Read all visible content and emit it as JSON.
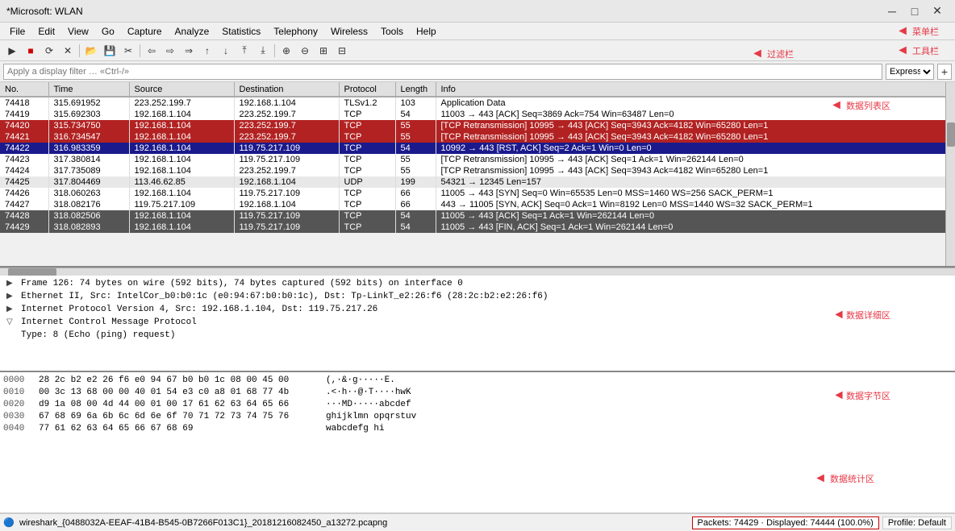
{
  "window": {
    "title": "*Microsoft: WLAN",
    "min_btn": "─",
    "max_btn": "□",
    "close_btn": "✕"
  },
  "menubar": {
    "items": [
      "File",
      "Edit",
      "View",
      "Go",
      "Capture",
      "Analyze",
      "Statistics",
      "Telephony",
      "Wireless",
      "Tools",
      "Help"
    ],
    "annotation": "菜单栏"
  },
  "toolbar": {
    "annotation": "工具栏",
    "buttons": [
      "▶",
      "■",
      "⟳",
      "✕",
      "⎙",
      "✂",
      "📋",
      "⬤",
      "↩",
      "→",
      "⇒",
      "⤼",
      "↑",
      "⬇",
      "↕",
      "⊕",
      "⊖",
      "⊕",
      "⊖",
      "⊞",
      "⊟"
    ]
  },
  "filterbar": {
    "placeholder": "Apply a display filter … «Ctrl-/»",
    "expression_btn": "Expression…",
    "add_btn": "+",
    "annotation": "过滤栏"
  },
  "columns": [
    "No.",
    "Time",
    "Source",
    "Destination",
    "Protocol",
    "Length",
    "Info"
  ],
  "packets": [
    {
      "no": "74418",
      "time": "315.691952",
      "src": "223.252.199.7",
      "dst": "192.168.1.104",
      "proto": "TLSv1.2",
      "len": "103",
      "info": "Application Data",
      "style": "row-white"
    },
    {
      "no": "74419",
      "time": "315.692303",
      "src": "192.168.1.104",
      "dst": "223.252.199.7",
      "proto": "TCP",
      "len": "54",
      "info": "11003 → 443 [ACK] Seq=3869 Ack=754 Win=63487 Len=0",
      "style": "row-white"
    },
    {
      "no": "74420",
      "time": "315.734750",
      "src": "192.168.1.104",
      "dst": "223.252.199.7",
      "proto": "TCP",
      "len": "55",
      "info": "[TCP Retransmission] 10995 → 443 [ACK] Seq=3943 Ack=4182 Win=65280 Len=1",
      "style": "row-dark-red"
    },
    {
      "no": "74421",
      "time": "316.734547",
      "src": "192.168.1.104",
      "dst": "223.252.199.7",
      "proto": "TCP",
      "len": "55",
      "info": "[TCP Retransmission] 10995 → 443 [ACK] Seq=3943 Ack=4182 Win=65280 Len=1",
      "style": "row-dark-red"
    },
    {
      "no": "74422",
      "time": "316.983359",
      "src": "192.168.1.104",
      "dst": "119.75.217.109",
      "proto": "TCP",
      "len": "54",
      "info": "10992 → 443 [RST, ACK] Seq=2 Ack=1 Win=0 Len=0",
      "style": "row-selected"
    },
    {
      "no": "74423",
      "time": "317.380814",
      "src": "192.168.1.104",
      "dst": "119.75.217.109",
      "proto": "TCP",
      "len": "55",
      "info": "[TCP Retransmission] 10995 → 443 [ACK] Seq=1 Ack=1 Win=262144 Len=0",
      "style": "row-white"
    },
    {
      "no": "74424",
      "time": "317.735089",
      "src": "192.168.1.104",
      "dst": "223.252.199.7",
      "proto": "TCP",
      "len": "55",
      "info": "[TCP Retransmission] 10995 → 443 [ACK] Seq=3943 Ack=4182 Win=65280 Len=1",
      "style": "row-white"
    },
    {
      "no": "74425",
      "time": "317.804469",
      "src": "113.46.62.85",
      "dst": "192.168.1.104",
      "proto": "UDP",
      "len": "199",
      "info": "54321 → 12345 Len=157",
      "style": "row-light-gray"
    },
    {
      "no": "74426",
      "time": "318.060263",
      "src": "192.168.1.104",
      "dst": "119.75.217.109",
      "proto": "TCP",
      "len": "66",
      "info": "11005 → 443 [SYN] Seq=0 Win=65535 Len=0 MSS=1460 WS=256 SACK_PERM=1",
      "style": "row-white"
    },
    {
      "no": "74427",
      "time": "318.082176",
      "src": "119.75.217.109",
      "dst": "192.168.1.104",
      "proto": "TCP",
      "len": "66",
      "info": "443 → 11005 [SYN, ACK] Seq=0 Ack=1 Win=8192 Len=0 MSS=1440 WS=32 SACK_PERM=1",
      "style": "row-white"
    },
    {
      "no": "74428",
      "time": "318.082506",
      "src": "192.168.1.104",
      "dst": "119.75.217.109",
      "proto": "TCP",
      "len": "54",
      "info": "11005 → 443 [ACK] Seq=1 Ack=1 Win=262144 Len=0",
      "style": "row-dark-gray"
    },
    {
      "no": "74429",
      "time": "318.082893",
      "src": "192.168.1.104",
      "dst": "119.75.217.109",
      "proto": "TCP",
      "len": "54",
      "info": "11005 → 443 [FIN, ACK] Seq=1 Ack=1 Win=262144 Len=0",
      "style": "row-dark-gray"
    }
  ],
  "detail_annotation": "数据详细区",
  "list_annotation": "数据列表区",
  "hex_annotation": "数据字节区",
  "stats_annotation": "数据统计区",
  "details": [
    {
      "icon": "▶",
      "text": "Frame 126: 74 bytes on wire (592 bits), 74 bytes captured (592 bits) on interface 0",
      "expanded": false
    },
    {
      "icon": "▶",
      "text": "Ethernet II, Src: IntelCor_b0:b0:1c (e0:94:67:b0:b0:1c), Dst: Tp-LinkT_e2:26:f6 (28:2c:b2:e2:26:f6)",
      "expanded": false
    },
    {
      "icon": "▶",
      "text": "Internet Protocol Version 4, Src: 192.168.1.104, Dst: 119.75.217.26",
      "expanded": false
    },
    {
      "icon": "▽",
      "text": "Internet Control Message Protocol",
      "expanded": true
    },
    {
      "icon": "",
      "text": "    Type: 8 (Echo (ping) request)",
      "expanded": false,
      "indent": true
    }
  ],
  "hex_rows": [
    {
      "offset": "0000",
      "bytes": "28 2c b2 e2 26 f6 e0 94  67 b0 b0 1c 08 00 45 00",
      "ascii": "(,·&·g·····E."
    },
    {
      "offset": "0010",
      "bytes": "00 3c 13 68 00 00 40 01  54 e3 c0 a8 01 68 77 4b",
      "ascii": ".<·h··@·T····hwK"
    },
    {
      "offset": "0020",
      "bytes": "d9 1a 08 00 4d 44 00 01  00 17 61 62 63 64 65 66",
      "ascii": "···MD·····abcdef"
    },
    {
      "offset": "0030",
      "bytes": "67 68 69 6a 6b 6c 6d 6e  6f 70 71 72 73 74 75 76",
      "ascii": "ghijklmn opqrstuv"
    },
    {
      "offset": "0040",
      "bytes": "77 61 62 63 64 65 66 67  68 69",
      "ascii": "wabcdefg hi"
    }
  ],
  "statusbar": {
    "file": "wireshark_{0488032A-EEAF-41B4-B545-0B7266F013C1}_20181216082450_a13272.pcapng",
    "packets": "Packets: 74429 · Displayed: 74444 (100.0%)",
    "profile": "Profile: Default"
  }
}
